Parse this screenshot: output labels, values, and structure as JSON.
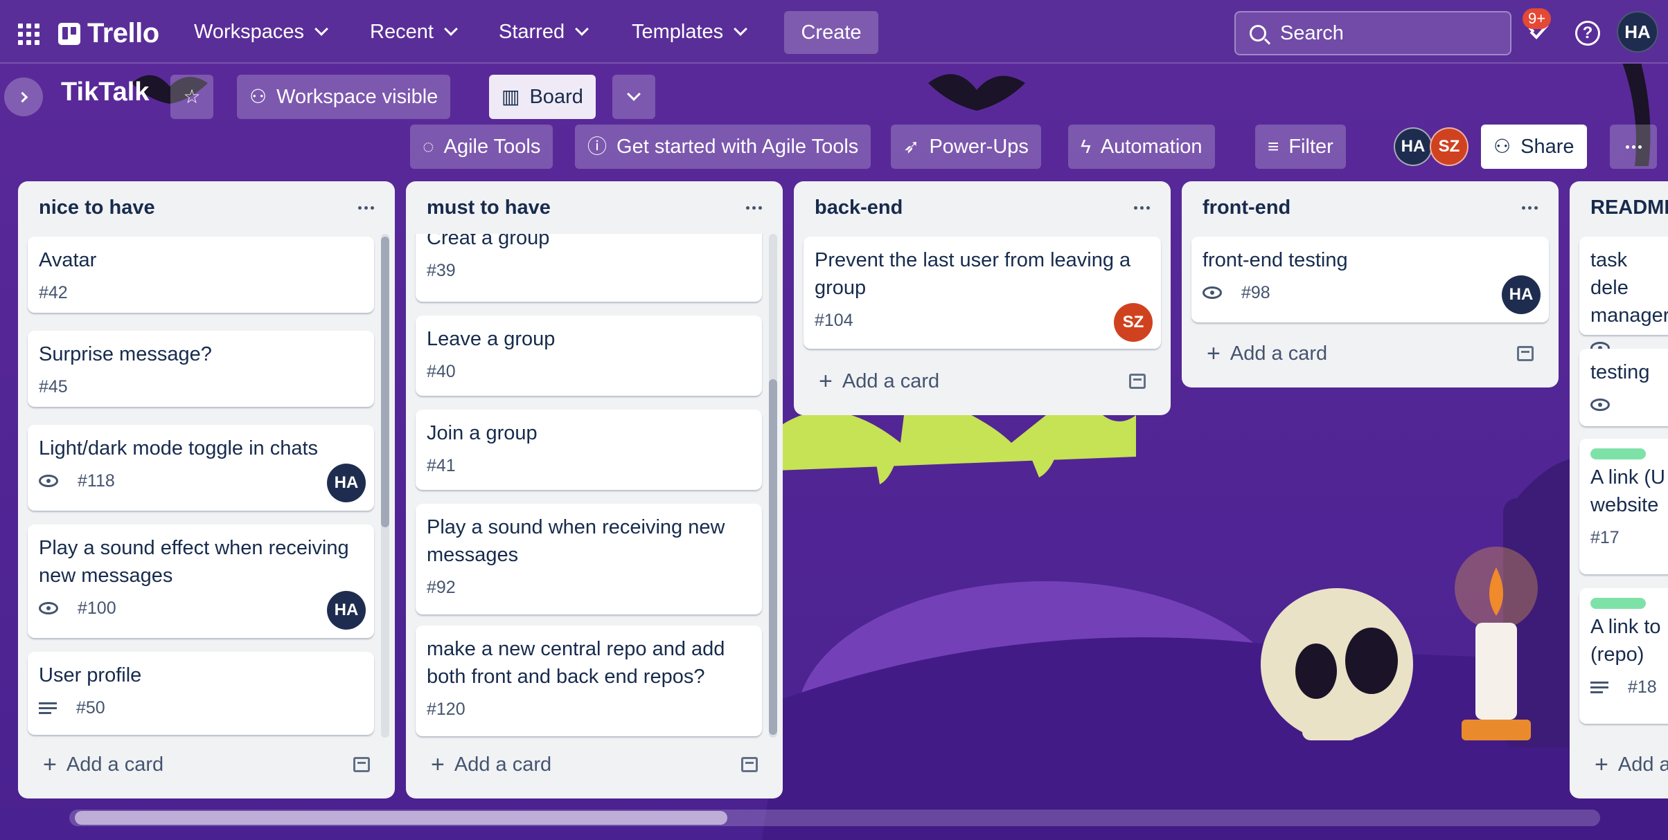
{
  "colors": {
    "nav_bg": "#5a2e99",
    "board_bg": "#5b2a9a",
    "list_bg": "#f1f2f4",
    "avatar_ha": "#1e2d4f",
    "avatar_sz": "#d0421f",
    "badge_red": "#e34935",
    "label_green": "#7ee2a8"
  },
  "nav": {
    "app_name": "Trello",
    "menus": [
      "Workspaces",
      "Recent",
      "Starred",
      "Templates"
    ],
    "create_label": "Create",
    "search_placeholder": "Search",
    "notification_badge": "9+",
    "user_initials": "HA"
  },
  "board": {
    "title": "TikTalk",
    "visibility_label": "Workspace visible",
    "view_label": "Board",
    "toolbar": {
      "agile_tools": "Agile Tools",
      "get_started": "Get started with Agile Tools",
      "power_ups": "Power-Ups",
      "automation": "Automation",
      "filter": "Filter",
      "share": "Share"
    },
    "members": [
      "HA",
      "SZ"
    ]
  },
  "add_card_label": "Add a card",
  "lists": [
    {
      "title": "nice to have",
      "cards": [
        {
          "title": "Avatar",
          "number": "#42"
        },
        {
          "title": "Surprise message?",
          "number": "#45"
        },
        {
          "title": "Light/dark mode toggle in chats",
          "number": "#118",
          "watch": true,
          "member": "HA"
        },
        {
          "title": "Play a sound effect when receiving new messages",
          "number": "#100",
          "watch": true,
          "member": "HA"
        },
        {
          "title": "User profile",
          "number": "#50",
          "description": true
        }
      ]
    },
    {
      "title": "must to have",
      "cards": [
        {
          "title": "Creat a group",
          "number": "#39"
        },
        {
          "title": "Leave a group",
          "number": "#40"
        },
        {
          "title": "Join a group",
          "number": "#41"
        },
        {
          "title": "Play a sound when receiving new messages",
          "number": "#92"
        },
        {
          "title": "make a new central repo and add both front and back end repos?",
          "number": "#120"
        }
      ]
    },
    {
      "title": "back-end",
      "cards": [
        {
          "title": "Prevent the last user from leaving a group",
          "number": "#104",
          "member": "SZ"
        }
      ]
    },
    {
      "title": "front-end",
      "cards": [
        {
          "title": "front-end testing",
          "number": "#98",
          "watch": true,
          "member": "HA"
        }
      ]
    },
    {
      "title": "READMI",
      "cards": [
        {
          "title": "task dele manager"
        },
        {
          "title": "testing"
        },
        {
          "title": "A link (U website",
          "number": "#17"
        },
        {
          "title": "A link to (repo)",
          "number": "#18"
        }
      ]
    }
  ],
  "icons": [
    "apps-grid-icon",
    "trello-logo-icon",
    "chevron-down-icon",
    "search-icon",
    "bell-icon",
    "help-icon",
    "star-icon",
    "people-icon",
    "board-icon",
    "eye-icon",
    "description-icon",
    "plus-icon",
    "template-icon",
    "filter-icon",
    "lightning-icon",
    "rocket-icon",
    "info-icon",
    "more-icon"
  ]
}
